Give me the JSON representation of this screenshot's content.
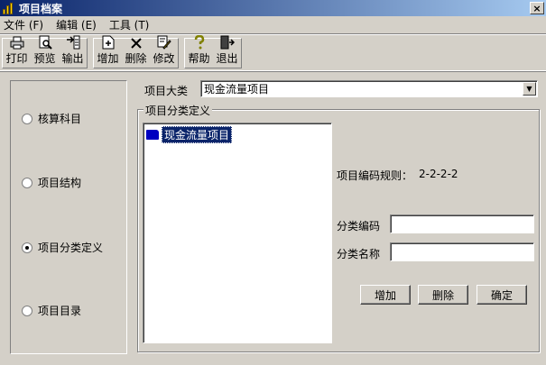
{
  "window": {
    "title": "项目档案",
    "close": "×"
  },
  "menu": [
    "文件 (F)",
    "编辑 (E)",
    "工具 (T)"
  ],
  "toolbar": {
    "print": "打印",
    "preview": "预览",
    "export": "输出",
    "add": "增加",
    "delete": "删除",
    "modify": "修改",
    "help": "帮助",
    "exit": "退出"
  },
  "left_options": {
    "account_subject": "核算科目",
    "structure": "项目结构",
    "category_definition": "项目分类定义",
    "catalog": "项目目录",
    "selected": "项目分类定义"
  },
  "major_class": {
    "label": "项目大类",
    "value": "现金流量项目"
  },
  "group": {
    "title": "项目分类定义"
  },
  "tree": {
    "root": "现金流量项目"
  },
  "coding_rule": {
    "label": "项目编码规则：",
    "value": "2-2-2-2"
  },
  "fields": {
    "code_label": "分类编码",
    "code_value": "",
    "name_label": "分类名称",
    "name_value": ""
  },
  "buttons": {
    "add": "增加",
    "delete": "删除",
    "confirm": "确定"
  }
}
